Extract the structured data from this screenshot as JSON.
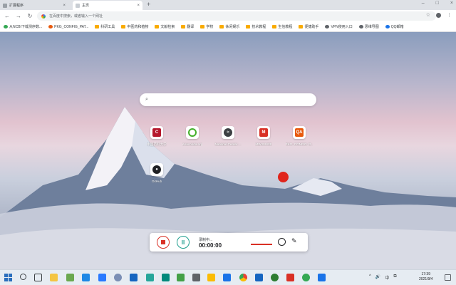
{
  "tabs": [
    {
      "label": "扩展程序",
      "active": false
    },
    {
      "label": "主页",
      "active": true
    }
  ],
  "new_tab_symbol": "+",
  "window_controls": {
    "minimize": "–",
    "maximize": "□",
    "close": "×"
  },
  "toolbar": {
    "back": "←",
    "forward": "→",
    "reload": "↻",
    "placeholder": "在百度中搜索，或者输入一个网址",
    "star": "☆",
    "menu": "⋮"
  },
  "bookmarks": [
    {
      "label": "从NCBI下载测序数...",
      "icon": "leaf-icon",
      "color": "#34a853"
    },
    {
      "label": "PKG_CONFIG_PAT...",
      "icon": "qa-icon",
      "color": "#e8590c"
    },
    {
      "label": "科研工具",
      "icon": "folder-icon",
      "color": "#f9ab00"
    },
    {
      "label": "中医药和植物",
      "icon": "folder-icon",
      "color": "#f9ab00"
    },
    {
      "label": "文献检索",
      "icon": "folder-icon",
      "color": "#f9ab00"
    },
    {
      "label": "翻译",
      "icon": "folder-icon",
      "color": "#f9ab00"
    },
    {
      "label": "学校",
      "icon": "folder-icon",
      "color": "#f9ab00"
    },
    {
      "label": "休闲娱乐",
      "icon": "folder-icon",
      "color": "#f9ab00"
    },
    {
      "label": "技术教程",
      "icon": "folder-icon",
      "color": "#f9ab00"
    },
    {
      "label": "生信教程",
      "icon": "folder-icon",
      "color": "#f9ab00"
    },
    {
      "label": "便捷助手",
      "icon": "folder-icon",
      "color": "#f9ab00"
    },
    {
      "label": "VPN使用入口",
      "icon": "globe-icon",
      "color": "#5f6368"
    },
    {
      "label": "思维导图",
      "icon": "globe-icon",
      "color": "#5f6368"
    },
    {
      "label": "QQ邮箱",
      "icon": "mail-icon",
      "color": "#1a73e8"
    }
  ],
  "search": {
    "icon": "search-icon"
  },
  "shortcuts": [
    {
      "label": "中国药科大学",
      "glyph": "C",
      "color": "#b5182c"
    },
    {
      "label": "Anaconda.org",
      "glyph": "",
      "color": "#43b02a"
    },
    {
      "label": "National Center ...",
      "glyph": "≈",
      "color": "#3c4043"
    },
    {
      "label": "MWJSURE",
      "glyph": "M",
      "color": "#d93025"
    },
    {
      "label": "PKG_CONFIG_P...",
      "glyph": "QA",
      "color": "#e8590c"
    },
    {
      "label": "GitHub",
      "glyph": "●",
      "color": "#202124"
    }
  ],
  "recorder": {
    "status": "录制中...",
    "time": "00:00:00",
    "pause_symbol": "II",
    "pen_symbol": "✎",
    "level_color": "#d93025"
  },
  "clock": {
    "time": "17:39",
    "date": "2021/9/4"
  },
  "tray_symbols": [
    "^",
    "🔊",
    "中",
    "⧉"
  ]
}
